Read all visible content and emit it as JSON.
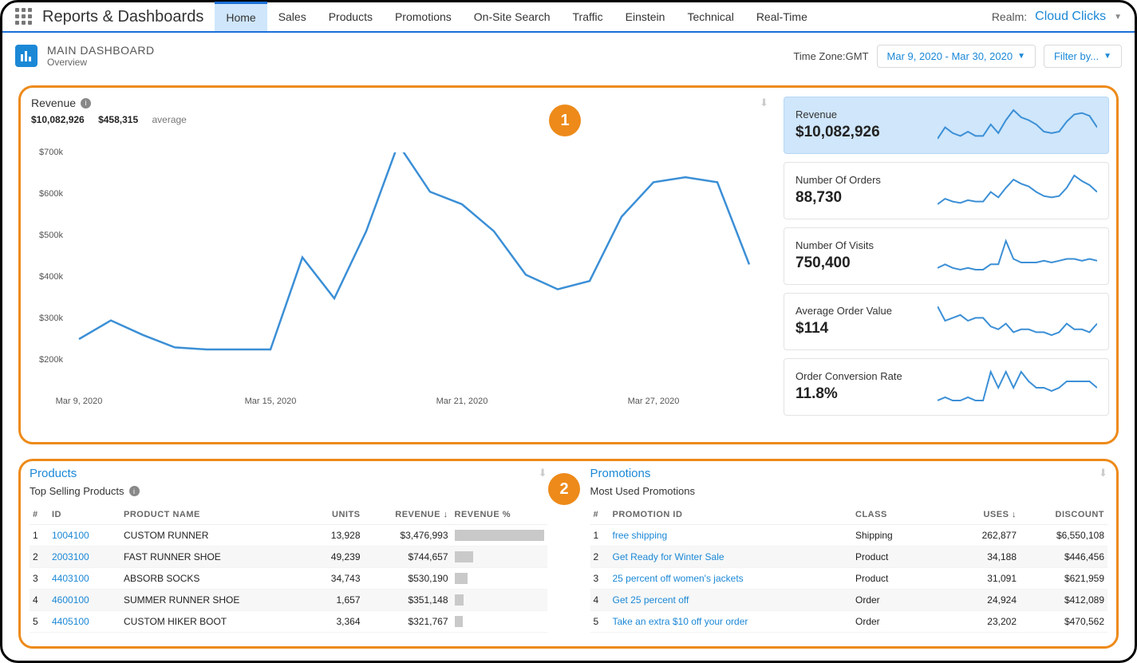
{
  "top": {
    "branding": "Reports & Dashboards",
    "tabs": [
      "Home",
      "Sales",
      "Products",
      "Promotions",
      "On-Site Search",
      "Traffic",
      "Einstein",
      "Technical",
      "Real-Time"
    ],
    "active_tab": "Home",
    "realm_label": "Realm:",
    "realm_value": "Cloud Clicks"
  },
  "header": {
    "title": "MAIN DASHBOARD",
    "subtitle": "Overview",
    "tz_label": "Time Zone:",
    "tz_value": "GMT",
    "date_range": "Mar 9, 2020 - Mar 30, 2020",
    "filter_label": "Filter by..."
  },
  "annotations": {
    "one": "1",
    "two": "2"
  },
  "chart_data": {
    "type": "line",
    "title": "Revenue",
    "total": "$10,082,926",
    "average_label": "average",
    "average": "$458,315",
    "ylabel": "",
    "ylim": [
      200000,
      700000
    ],
    "y_ticks": [
      "$200k",
      "$300k",
      "$400k",
      "$500k",
      "$600k",
      "$700k"
    ],
    "x_ticks": [
      "Mar 9, 2020",
      "Mar 15, 2020",
      "Mar 21, 2020",
      "Mar 27, 2020"
    ],
    "x": [
      "Mar 9",
      "Mar 10",
      "Mar 11",
      "Mar 12",
      "Mar 13",
      "Mar 14",
      "Mar 15",
      "Mar 16",
      "Mar 17",
      "Mar 18",
      "Mar 19",
      "Mar 20",
      "Mar 21",
      "Mar 22",
      "Mar 23",
      "Mar 24",
      "Mar 25",
      "Mar 26",
      "Mar 27",
      "Mar 28",
      "Mar 29",
      "Mar 30"
    ],
    "values": [
      250000,
      295000,
      260000,
      230000,
      225000,
      225000,
      225000,
      447000,
      348000,
      510000,
      720000,
      605000,
      575000,
      510000,
      405000,
      370000,
      390000,
      545000,
      628000,
      640000,
      628000,
      430000
    ]
  },
  "sparks": [
    {
      "label": "Revenue",
      "value": "$10,082,926",
      "pts": [
        20,
        28,
        24,
        22,
        25,
        22,
        22,
        30,
        24,
        33,
        40,
        35,
        33,
        30,
        25,
        24,
        25,
        32,
        37,
        38,
        36,
        28
      ],
      "active": true
    },
    {
      "label": "Number Of Orders",
      "value": "88,730",
      "pts": [
        18,
        22,
        20,
        19,
        21,
        20,
        20,
        27,
        23,
        30,
        36,
        33,
        31,
        27,
        24,
        23,
        24,
        30,
        39,
        35,
        32,
        27
      ],
      "active": false
    },
    {
      "label": "Number Of Visits",
      "value": "750,400",
      "pts": [
        22,
        24,
        22,
        21,
        22,
        21,
        21,
        24,
        24,
        37,
        27,
        25,
        25,
        25,
        26,
        25,
        26,
        27,
        27,
        26,
        27,
        26
      ],
      "active": false
    },
    {
      "label": "Average Order Value",
      "value": "$114",
      "pts": [
        30,
        25,
        26,
        27,
        25,
        26,
        26,
        23,
        22,
        24,
        21,
        22,
        22,
        21,
        21,
        20,
        21,
        24,
        22,
        22,
        21,
        24
      ],
      "active": false
    },
    {
      "label": "Order Conversion Rate",
      "value": "11.8%",
      "pts": [
        21,
        22,
        21,
        21,
        22,
        21,
        21,
        30,
        25,
        30,
        25,
        30,
        27,
        25,
        25,
        24,
        25,
        27,
        27,
        27,
        27,
        25
      ],
      "active": false
    }
  ],
  "products": {
    "title": "Products",
    "subtitle": "Top Selling Products",
    "cols": {
      "num": "#",
      "id": "ID",
      "name": "PRODUCT NAME",
      "units": "UNITS",
      "revenue": "REVENUE",
      "pct": "REVENUE %"
    },
    "rows": [
      {
        "n": "1",
        "id": "1004100",
        "name": "CUSTOM RUNNER",
        "units": "13,928",
        "revenue": "$3,476,993",
        "pct": 100
      },
      {
        "n": "2",
        "id": "2003100",
        "name": "FAST RUNNER SHOE",
        "units": "49,239",
        "revenue": "$744,657",
        "pct": 21
      },
      {
        "n": "3",
        "id": "4403100",
        "name": "ABSORB SOCKS",
        "units": "34,743",
        "revenue": "$530,190",
        "pct": 15
      },
      {
        "n": "4",
        "id": "4600100",
        "name": "SUMMER RUNNER SHOE",
        "units": "1,657",
        "revenue": "$351,148",
        "pct": 10
      },
      {
        "n": "5",
        "id": "4405100",
        "name": "CUSTOM HIKER BOOT",
        "units": "3,364",
        "revenue": "$321,767",
        "pct": 9
      }
    ]
  },
  "promotions": {
    "title": "Promotions",
    "subtitle": "Most Used Promotions",
    "cols": {
      "num": "#",
      "id": "PROMOTION ID",
      "cls": "CLASS",
      "uses": "USES",
      "disc": "DISCOUNT"
    },
    "rows": [
      {
        "n": "1",
        "id": "free shipping",
        "cls": "Shipping",
        "uses": "262,877",
        "disc": "$6,550,108"
      },
      {
        "n": "2",
        "id": "Get Ready for Winter Sale",
        "cls": "Product",
        "uses": "34,188",
        "disc": "$446,456"
      },
      {
        "n": "3",
        "id": "25 percent off women's jackets",
        "cls": "Product",
        "uses": "31,091",
        "disc": "$621,959"
      },
      {
        "n": "4",
        "id": "Get 25 percent off",
        "cls": "Order",
        "uses": "24,924",
        "disc": "$412,089"
      },
      {
        "n": "5",
        "id": "Take an extra $10 off your order",
        "cls": "Order",
        "uses": "23,202",
        "disc": "$470,562"
      }
    ]
  }
}
